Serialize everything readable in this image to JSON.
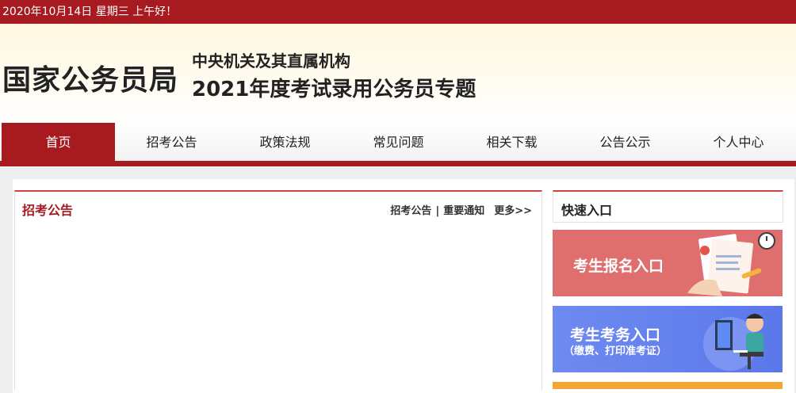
{
  "topbar": {
    "date_text": "2020年10月14日  星期三  上午好！"
  },
  "header": {
    "site_name": "国家公务员局",
    "subtitle_line1": "中央机关及其直属机构",
    "subtitle_line2": "2021年度考试录用公务员专题"
  },
  "nav": {
    "items": [
      {
        "label": "首页",
        "active": true
      },
      {
        "label": "招考公告"
      },
      {
        "label": "政策法规"
      },
      {
        "label": "常见问题"
      },
      {
        "label": "相关下载"
      },
      {
        "label": "公告公示"
      },
      {
        "label": "个人中心"
      }
    ]
  },
  "announcements": {
    "title": "招考公告",
    "link1": "招考公告",
    "separator": "|",
    "link2": "重要通知",
    "more": "更多>>"
  },
  "quick_entry": {
    "title": "快速入口",
    "register_label": "考生报名入口",
    "exam_label": "考生考务入口",
    "exam_sub": "（缴费、打印准考证）"
  },
  "colors": {
    "brand_red": "#a71a20",
    "banner_red": "#df6e6e",
    "banner_blue": "#6f8af0",
    "banner_orange": "#f3a732"
  }
}
